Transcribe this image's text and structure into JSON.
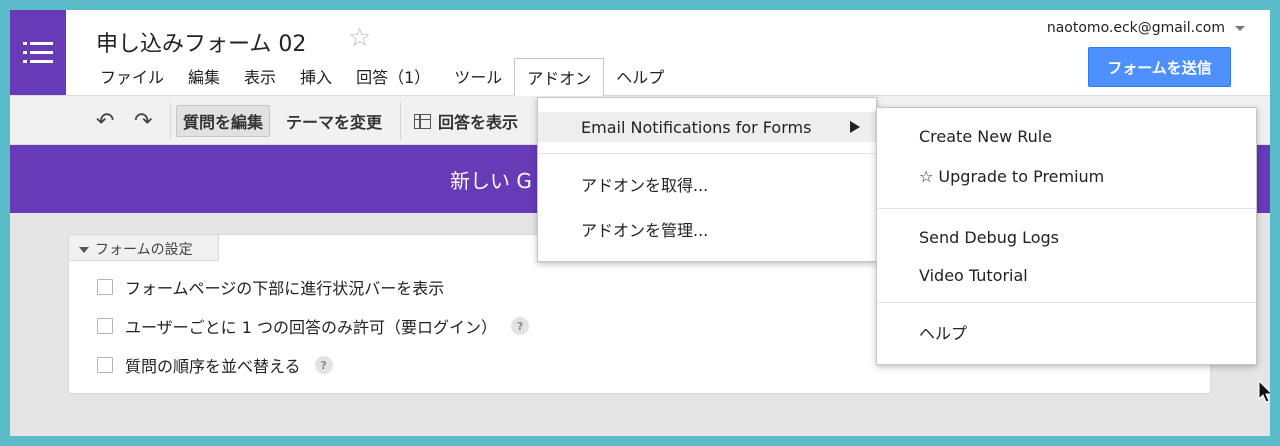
{
  "header": {
    "title": "申し込みフォーム 02",
    "star_icon": "star-outline-icon",
    "account": "naotomo.eck@gmail.com",
    "send_button": "フォームを送信"
  },
  "menubar": {
    "items": [
      "ファイル",
      "編集",
      "表示",
      "挿入",
      "回答（1）",
      "ツール",
      "アドオン",
      "ヘルプ"
    ],
    "active": "アドオン"
  },
  "toolbar": {
    "undo_icon": "↶",
    "redo_icon": "↷",
    "edit_questions": "質問を編集",
    "change_theme": "テーマを変更",
    "view_responses": "回答を表示"
  },
  "banner": {
    "title": "新しい G"
  },
  "settings": {
    "tab": "フォームの設定",
    "options": [
      "フォームページの下部に進行状況バーを表示",
      "ユーザーごとに 1 つの回答のみ許可（要ログイン）",
      "質問の順序を並べ替える"
    ],
    "help_glyph": "?"
  },
  "addon_menu": {
    "items": [
      "Email Notifications for Forms",
      "アドオンを取得...",
      "アドオンを管理..."
    ]
  },
  "submenu": {
    "items": [
      "Create New Rule",
      "☆ Upgrade to Premium",
      "Send Debug Logs",
      "Video Tutorial",
      "ヘルプ"
    ]
  },
  "colors": {
    "purple": "#673ab7",
    "blue_button": "#4d90fe",
    "frame_border": "#5bbcc9"
  }
}
